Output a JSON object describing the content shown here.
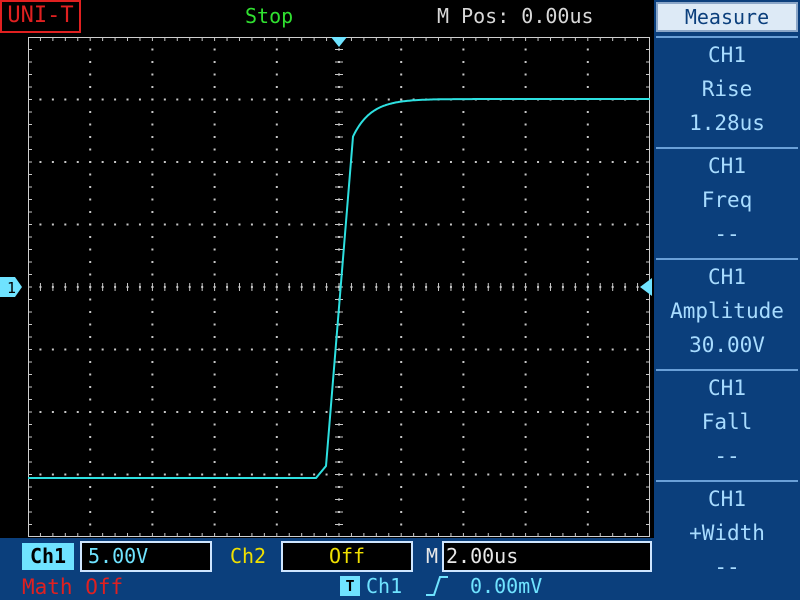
{
  "header": {
    "brand": "UNI-T",
    "run_status": "Stop",
    "m_pos": "M Pos: 0.00us"
  },
  "menu": {
    "title": "Measure",
    "items": [
      {
        "channel": "CH1",
        "name": "Rise",
        "value": "1.28us"
      },
      {
        "channel": "CH1",
        "name": "Freq",
        "value": "--"
      },
      {
        "channel": "CH1",
        "name": "Amplitude",
        "value": "30.00V"
      },
      {
        "channel": "CH1",
        "name": "Fall",
        "value": "--"
      },
      {
        "channel": "CH1",
        "name": "+Width",
        "value": "--"
      }
    ]
  },
  "markers": {
    "ch1_ground": "1"
  },
  "bottom": {
    "ch1_label": "Ch1",
    "ch1_scale": "5.00V",
    "ch2_label": "Ch2",
    "ch2_scale": "Off",
    "m_label": "M",
    "timebase": "2.00us",
    "math": "Math Off",
    "trigger_icon": "T",
    "trigger_source": "Ch1",
    "trigger_level": "0.00mV"
  },
  "colors": {
    "trace": "#2de0e0",
    "ch1": "#6fe3ff",
    "ch2": "#f0e000",
    "brand": "#e02020",
    "status": "#30e030",
    "panel": "#0b3f7c"
  },
  "icons": {
    "trigger_position": "triangle-down-icon",
    "ch1_ground": "arrow-right-marker-icon",
    "trigger_level": "arrow-left-marker-icon",
    "trigger_slope": "rising-edge-icon"
  }
}
